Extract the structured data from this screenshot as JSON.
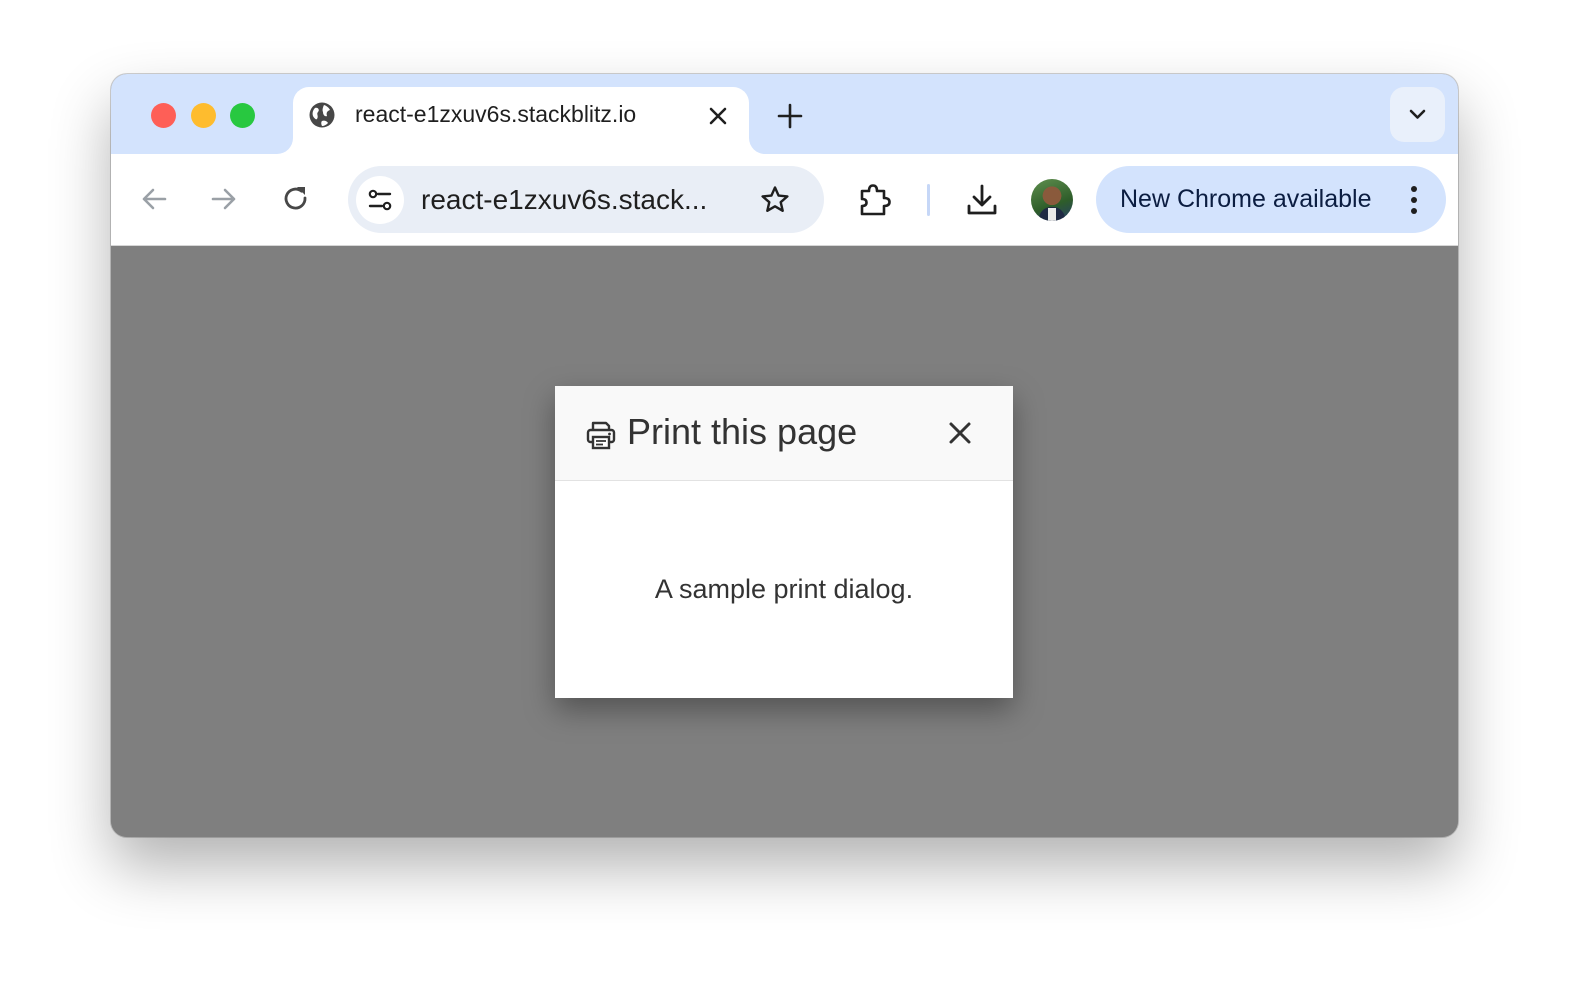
{
  "tab": {
    "title": "react-e1zxuv6s.stackblitz.io"
  },
  "toolbar": {
    "url": "react-e1zxuv6s.stack...",
    "update_label": "New Chrome available"
  },
  "dialog": {
    "title": "Print this page",
    "body": "A sample print dialog."
  },
  "icons": {
    "tab_favicon": "globe-icon",
    "tab_close": "close-icon",
    "new_tab": "plus-icon",
    "tab_search": "chevron-down-icon",
    "back": "arrow-left-icon",
    "forward": "arrow-right-icon",
    "reload": "reload-icon",
    "site_info": "tune-icon",
    "bookmark": "star-icon",
    "extensions": "puzzle-icon",
    "downloads": "download-icon",
    "menu": "vertical-dots-icon",
    "print": "printer-icon",
    "dialog_close": "close-icon"
  },
  "colors": {
    "tabstrip": "#d3e3fd",
    "omnibox": "#e9eef6",
    "page_overlay": "#7f7f7f",
    "update_pill": "#d3e3fd"
  }
}
